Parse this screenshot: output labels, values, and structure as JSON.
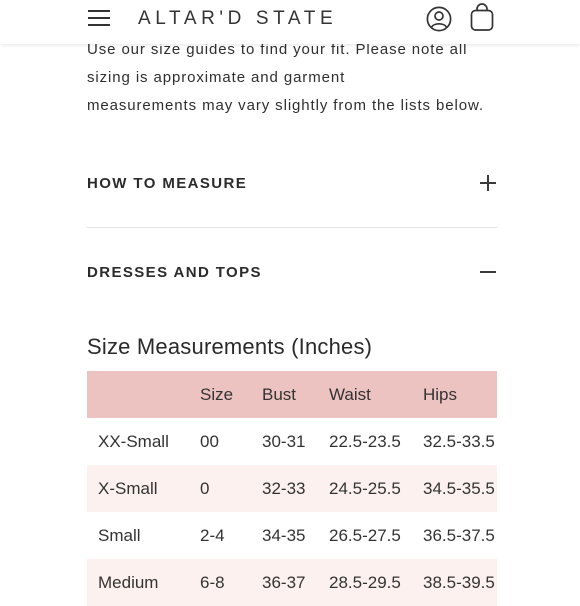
{
  "header": {
    "menu_icon": "hamburger-menu-icon",
    "logo_text": "ALTAR'D STATE",
    "account_icon": "user-account-icon",
    "bag_icon": "shopping-bag-icon"
  },
  "intro": {
    "line1": "Use our size guides to find your fit. Please note all",
    "line2": "sizing is approximate and garment",
    "line3": "measurements may vary slightly from the lists below."
  },
  "accordions": [
    {
      "title": "HOW TO MEASURE",
      "state": "collapsed",
      "icon": "plus-icon"
    },
    {
      "title": "DRESSES AND TOPS",
      "state": "expanded",
      "icon": "minus-icon"
    }
  ],
  "size_table": {
    "title": "Size Measurements (Inches)",
    "header_color": "#ecc3c1",
    "stripe_color": "#fdf1ef",
    "columns": [
      "",
      "Size",
      "Bust",
      "Waist",
      "Hips"
    ],
    "rows": [
      [
        "XX-Small",
        "00",
        "30-31",
        "22.5-23.5",
        "32.5-33.5"
      ],
      [
        "X-Small",
        "0",
        "32-33",
        "24.5-25.5",
        "34.5-35.5"
      ],
      [
        "Small",
        "2-4",
        "34-35",
        "26.5-27.5",
        "36.5-37.5"
      ],
      [
        "Medium",
        "6-8",
        "36-37",
        "28.5-29.5",
        "38.5-39.5"
      ]
    ]
  }
}
